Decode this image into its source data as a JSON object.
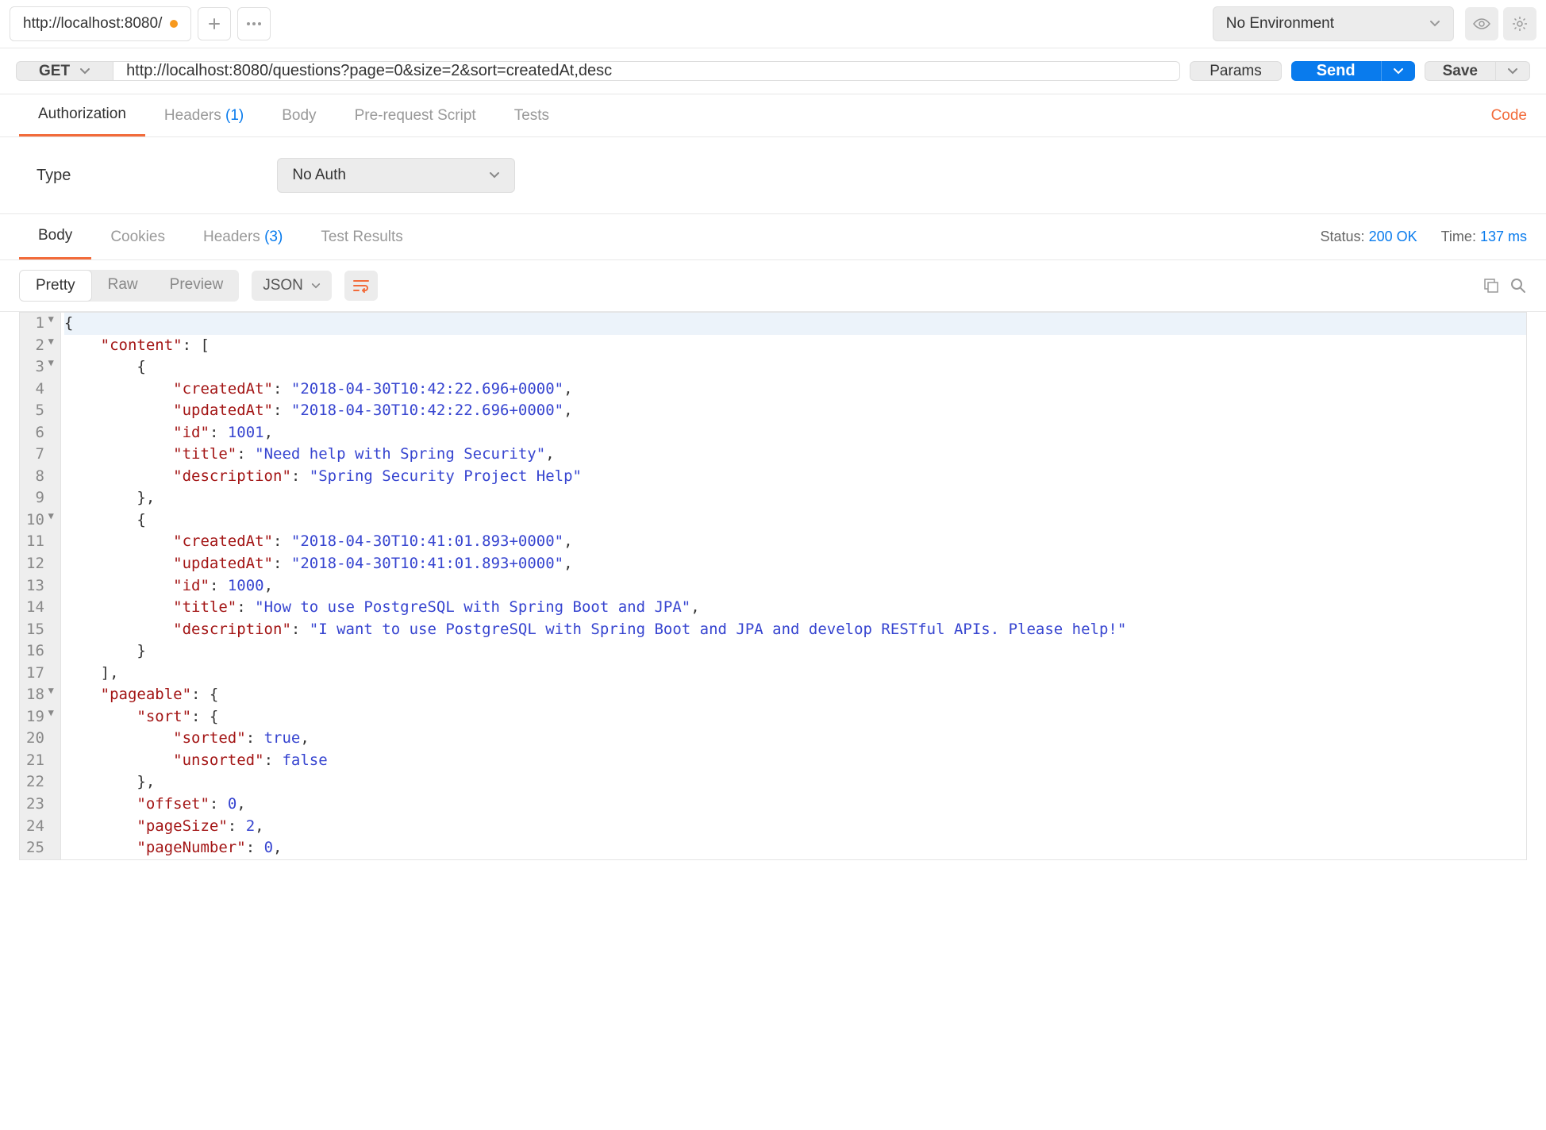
{
  "topbar": {
    "tab_title": "http://localhost:8080/",
    "env_label": "No Environment"
  },
  "request": {
    "method": "GET",
    "url": "http://localhost:8080/questions?page=0&size=2&sort=createdAt,desc",
    "params_label": "Params",
    "send_label": "Send",
    "save_label": "Save"
  },
  "req_tabs": {
    "authorization": "Authorization",
    "headers": "Headers",
    "headers_count": "(1)",
    "body": "Body",
    "prerequest": "Pre-request Script",
    "tests": "Tests",
    "code": "Code"
  },
  "auth": {
    "type_label": "Type",
    "type_value": "No Auth"
  },
  "resp_tabs": {
    "body": "Body",
    "cookies": "Cookies",
    "headers": "Headers",
    "headers_count": "(3)",
    "test_results": "Test Results"
  },
  "resp_meta": {
    "status_label": "Status:",
    "status_value": "200 OK",
    "time_label": "Time:",
    "time_value": "137 ms"
  },
  "body_toolbar": {
    "pretty": "Pretty",
    "raw": "Raw",
    "preview": "Preview",
    "format": "JSON"
  },
  "response_body": {
    "content": [
      {
        "createdAt": "2018-04-30T10:42:22.696+0000",
        "updatedAt": "2018-04-30T10:42:22.696+0000",
        "id": 1001,
        "title": "Need help with Spring Security",
        "description": "Spring Security Project Help"
      },
      {
        "createdAt": "2018-04-30T10:41:01.893+0000",
        "updatedAt": "2018-04-30T10:41:01.893+0000",
        "id": 1000,
        "title": "How to use PostgreSQL with Spring Boot and JPA",
        "description": "I want to use PostgreSQL with Spring Boot and JPA and develop RESTful APIs. Please help!"
      }
    ],
    "pageable": {
      "sort": {
        "sorted": true,
        "unsorted": false
      },
      "offset": 0,
      "pageSize": 2,
      "pageNumber": 0
    }
  },
  "code_lines": [
    {
      "n": 1,
      "fold": true,
      "segs": [
        {
          "t": "{",
          "c": "p"
        }
      ],
      "hl": true
    },
    {
      "n": 2,
      "fold": true,
      "segs": [
        {
          "t": "    ",
          "c": "p"
        },
        {
          "t": "\"content\"",
          "c": "k"
        },
        {
          "t": ": [",
          "c": "p"
        }
      ]
    },
    {
      "n": 3,
      "fold": true,
      "segs": [
        {
          "t": "        {",
          "c": "p"
        }
      ]
    },
    {
      "n": 4,
      "segs": [
        {
          "t": "            ",
          "c": "p"
        },
        {
          "t": "\"createdAt\"",
          "c": "k"
        },
        {
          "t": ": ",
          "c": "p"
        },
        {
          "t": "\"2018-04-30T10:42:22.696+0000\"",
          "c": "s"
        },
        {
          "t": ",",
          "c": "p"
        }
      ]
    },
    {
      "n": 5,
      "segs": [
        {
          "t": "            ",
          "c": "p"
        },
        {
          "t": "\"updatedAt\"",
          "c": "k"
        },
        {
          "t": ": ",
          "c": "p"
        },
        {
          "t": "\"2018-04-30T10:42:22.696+0000\"",
          "c": "s"
        },
        {
          "t": ",",
          "c": "p"
        }
      ]
    },
    {
      "n": 6,
      "segs": [
        {
          "t": "            ",
          "c": "p"
        },
        {
          "t": "\"id\"",
          "c": "k"
        },
        {
          "t": ": ",
          "c": "p"
        },
        {
          "t": "1001",
          "c": "n"
        },
        {
          "t": ",",
          "c": "p"
        }
      ]
    },
    {
      "n": 7,
      "segs": [
        {
          "t": "            ",
          "c": "p"
        },
        {
          "t": "\"title\"",
          "c": "k"
        },
        {
          "t": ": ",
          "c": "p"
        },
        {
          "t": "\"Need help with Spring Security\"",
          "c": "s"
        },
        {
          "t": ",",
          "c": "p"
        }
      ]
    },
    {
      "n": 8,
      "segs": [
        {
          "t": "            ",
          "c": "p"
        },
        {
          "t": "\"description\"",
          "c": "k"
        },
        {
          "t": ": ",
          "c": "p"
        },
        {
          "t": "\"Spring Security Project Help\"",
          "c": "s"
        }
      ]
    },
    {
      "n": 9,
      "segs": [
        {
          "t": "        },",
          "c": "p"
        }
      ]
    },
    {
      "n": 10,
      "fold": true,
      "segs": [
        {
          "t": "        {",
          "c": "p"
        }
      ]
    },
    {
      "n": 11,
      "segs": [
        {
          "t": "            ",
          "c": "p"
        },
        {
          "t": "\"createdAt\"",
          "c": "k"
        },
        {
          "t": ": ",
          "c": "p"
        },
        {
          "t": "\"2018-04-30T10:41:01.893+0000\"",
          "c": "s"
        },
        {
          "t": ",",
          "c": "p"
        }
      ]
    },
    {
      "n": 12,
      "segs": [
        {
          "t": "            ",
          "c": "p"
        },
        {
          "t": "\"updatedAt\"",
          "c": "k"
        },
        {
          "t": ": ",
          "c": "p"
        },
        {
          "t": "\"2018-04-30T10:41:01.893+0000\"",
          "c": "s"
        },
        {
          "t": ",",
          "c": "p"
        }
      ]
    },
    {
      "n": 13,
      "segs": [
        {
          "t": "            ",
          "c": "p"
        },
        {
          "t": "\"id\"",
          "c": "k"
        },
        {
          "t": ": ",
          "c": "p"
        },
        {
          "t": "1000",
          "c": "n"
        },
        {
          "t": ",",
          "c": "p"
        }
      ]
    },
    {
      "n": 14,
      "segs": [
        {
          "t": "            ",
          "c": "p"
        },
        {
          "t": "\"title\"",
          "c": "k"
        },
        {
          "t": ": ",
          "c": "p"
        },
        {
          "t": "\"How to use PostgreSQL with Spring Boot and JPA\"",
          "c": "s"
        },
        {
          "t": ",",
          "c": "p"
        }
      ]
    },
    {
      "n": 15,
      "segs": [
        {
          "t": "            ",
          "c": "p"
        },
        {
          "t": "\"description\"",
          "c": "k"
        },
        {
          "t": ": ",
          "c": "p"
        },
        {
          "t": "\"I want to use PostgreSQL with Spring Boot and JPA and develop RESTful APIs. Please help!\"",
          "c": "s"
        }
      ]
    },
    {
      "n": 16,
      "segs": [
        {
          "t": "        }",
          "c": "p"
        }
      ]
    },
    {
      "n": 17,
      "segs": [
        {
          "t": "    ],",
          "c": "p"
        }
      ]
    },
    {
      "n": 18,
      "fold": true,
      "segs": [
        {
          "t": "    ",
          "c": "p"
        },
        {
          "t": "\"pageable\"",
          "c": "k"
        },
        {
          "t": ": {",
          "c": "p"
        }
      ]
    },
    {
      "n": 19,
      "fold": true,
      "segs": [
        {
          "t": "        ",
          "c": "p"
        },
        {
          "t": "\"sort\"",
          "c": "k"
        },
        {
          "t": ": {",
          "c": "p"
        }
      ]
    },
    {
      "n": 20,
      "segs": [
        {
          "t": "            ",
          "c": "p"
        },
        {
          "t": "\"sorted\"",
          "c": "k"
        },
        {
          "t": ": ",
          "c": "p"
        },
        {
          "t": "true",
          "c": "b"
        },
        {
          "t": ",",
          "c": "p"
        }
      ]
    },
    {
      "n": 21,
      "segs": [
        {
          "t": "            ",
          "c": "p"
        },
        {
          "t": "\"unsorted\"",
          "c": "k"
        },
        {
          "t": ": ",
          "c": "p"
        },
        {
          "t": "false",
          "c": "b"
        }
      ]
    },
    {
      "n": 22,
      "segs": [
        {
          "t": "        },",
          "c": "p"
        }
      ]
    },
    {
      "n": 23,
      "segs": [
        {
          "t": "        ",
          "c": "p"
        },
        {
          "t": "\"offset\"",
          "c": "k"
        },
        {
          "t": ": ",
          "c": "p"
        },
        {
          "t": "0",
          "c": "n"
        },
        {
          "t": ",",
          "c": "p"
        }
      ]
    },
    {
      "n": 24,
      "segs": [
        {
          "t": "        ",
          "c": "p"
        },
        {
          "t": "\"pageSize\"",
          "c": "k"
        },
        {
          "t": ": ",
          "c": "p"
        },
        {
          "t": "2",
          "c": "n"
        },
        {
          "t": ",",
          "c": "p"
        }
      ]
    },
    {
      "n": 25,
      "segs": [
        {
          "t": "        ",
          "c": "p"
        },
        {
          "t": "\"pageNumber\"",
          "c": "k"
        },
        {
          "t": ": ",
          "c": "p"
        },
        {
          "t": "0",
          "c": "n"
        },
        {
          "t": ",",
          "c": "p"
        }
      ]
    }
  ]
}
